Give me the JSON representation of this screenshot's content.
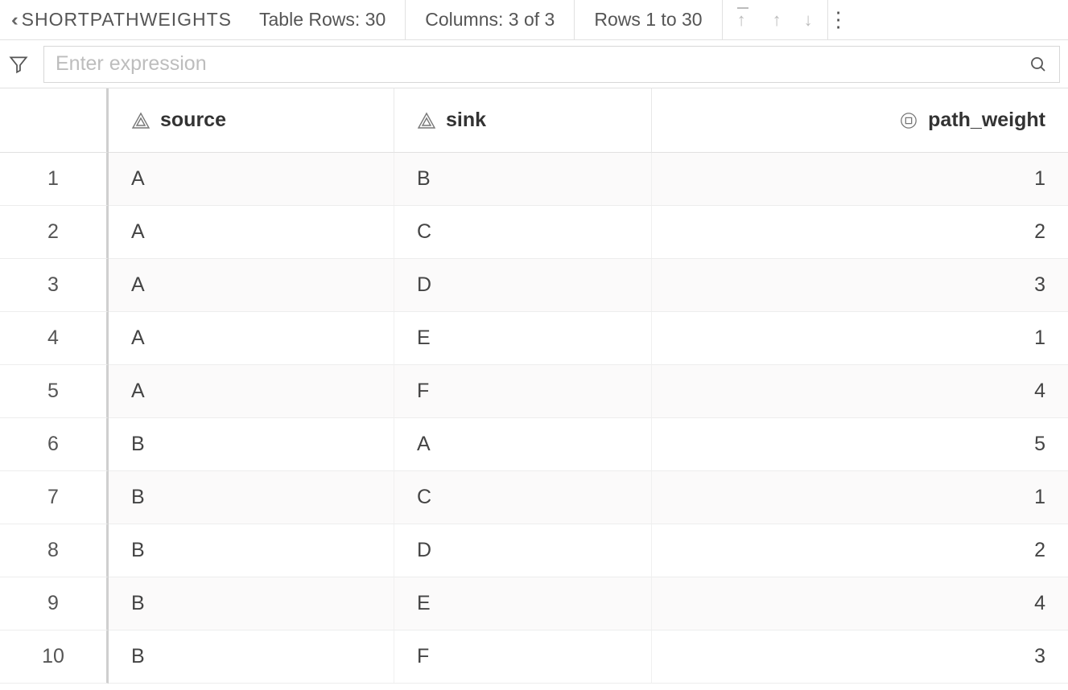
{
  "toolbar": {
    "title": "SHORTPATHWEIGHTS",
    "rows_label": "Table Rows: 30",
    "columns_label": "Columns: 3 of 3",
    "range_label": "Rows 1 to 30"
  },
  "filter": {
    "placeholder": "Enter expression"
  },
  "columns": [
    {
      "key": "source",
      "label": "source",
      "type": "text"
    },
    {
      "key": "sink",
      "label": "sink",
      "type": "text"
    },
    {
      "key": "path_weight",
      "label": "path_weight",
      "type": "number"
    }
  ],
  "rows": [
    {
      "n": "1",
      "source": "A",
      "sink": "B",
      "path_weight": "1"
    },
    {
      "n": "2",
      "source": "A",
      "sink": "C",
      "path_weight": "2"
    },
    {
      "n": "3",
      "source": "A",
      "sink": "D",
      "path_weight": "3"
    },
    {
      "n": "4",
      "source": "A",
      "sink": "E",
      "path_weight": "1"
    },
    {
      "n": "5",
      "source": "A",
      "sink": "F",
      "path_weight": "4"
    },
    {
      "n": "6",
      "source": "B",
      "sink": "A",
      "path_weight": "5"
    },
    {
      "n": "7",
      "source": "B",
      "sink": "C",
      "path_weight": "1"
    },
    {
      "n": "8",
      "source": "B",
      "sink": "D",
      "path_weight": "2"
    },
    {
      "n": "9",
      "source": "B",
      "sink": "E",
      "path_weight": "4"
    },
    {
      "n": "10",
      "source": "B",
      "sink": "F",
      "path_weight": "3"
    }
  ]
}
